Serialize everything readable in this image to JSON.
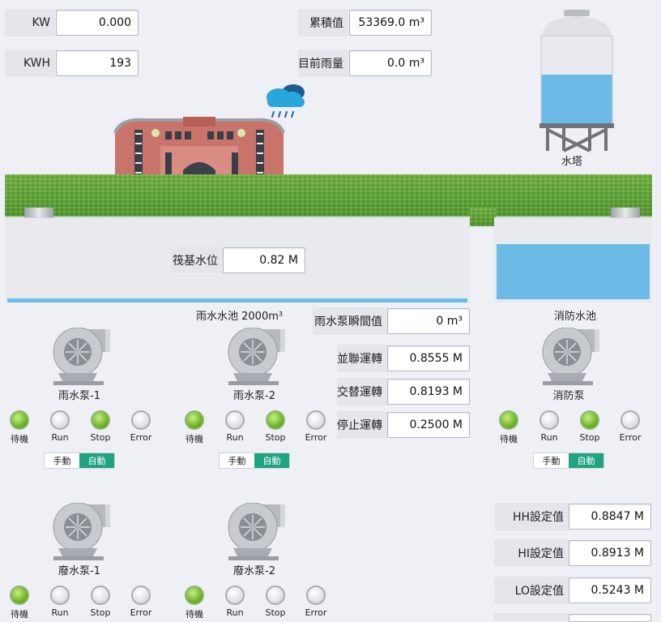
{
  "power": {
    "kw_label": "KW",
    "kw_value": "0.000",
    "kwh_label": "KWH",
    "kwh_value": "193"
  },
  "rain": {
    "cumulative_label": "累積值",
    "cumulative_value": "53369.0 m³",
    "current_label": "目前雨量",
    "current_value": "0.0 m³"
  },
  "water_tower": {
    "label": "水塔",
    "fill": 0.56
  },
  "raft_level": {
    "label": "筏基水位",
    "value": "0.82 M"
  },
  "rain_tank": {
    "label": "雨水水池 2000m³"
  },
  "fire_tank": {
    "label": "消防水池",
    "fill": 0.8
  },
  "pump_flow": {
    "label": "雨水泵瞬間值",
    "value": "0 m³"
  },
  "modes": [
    {
      "label": "並聯運轉",
      "value": "0.8555 M"
    },
    {
      "label": "交替運轉",
      "value": "0.8193 M"
    },
    {
      "label": "停止運轉",
      "value": "0.2500 M"
    }
  ],
  "setpoints": [
    {
      "label": "HH設定值",
      "value": "0.8847 M"
    },
    {
      "label": "HI設定值",
      "value": "0.8913 M"
    },
    {
      "label": "LO設定值",
      "value": "0.5243 M"
    }
  ],
  "status_labels": [
    "待機",
    "Run",
    "Stop",
    "Error"
  ],
  "toggle": {
    "manual": "手動",
    "auto": "自動"
  },
  "pumps": [
    {
      "name": "雨水泵-1",
      "states": [
        true,
        false,
        true,
        false
      ]
    },
    {
      "name": "雨水泵-2",
      "states": [
        true,
        false,
        true,
        false
      ]
    },
    {
      "name": "消防泵",
      "states": [
        true,
        false,
        true,
        false
      ]
    },
    {
      "name": "廢水泵-1",
      "states": [
        true,
        false,
        false,
        false
      ]
    },
    {
      "name": "廢水泵-2",
      "states": [
        true,
        false,
        false,
        false
      ]
    }
  ],
  "colors": {
    "water": "#6cbbe6",
    "grass": "#5ea632",
    "accent": "#1fa380",
    "light_on": "#6fb428"
  }
}
